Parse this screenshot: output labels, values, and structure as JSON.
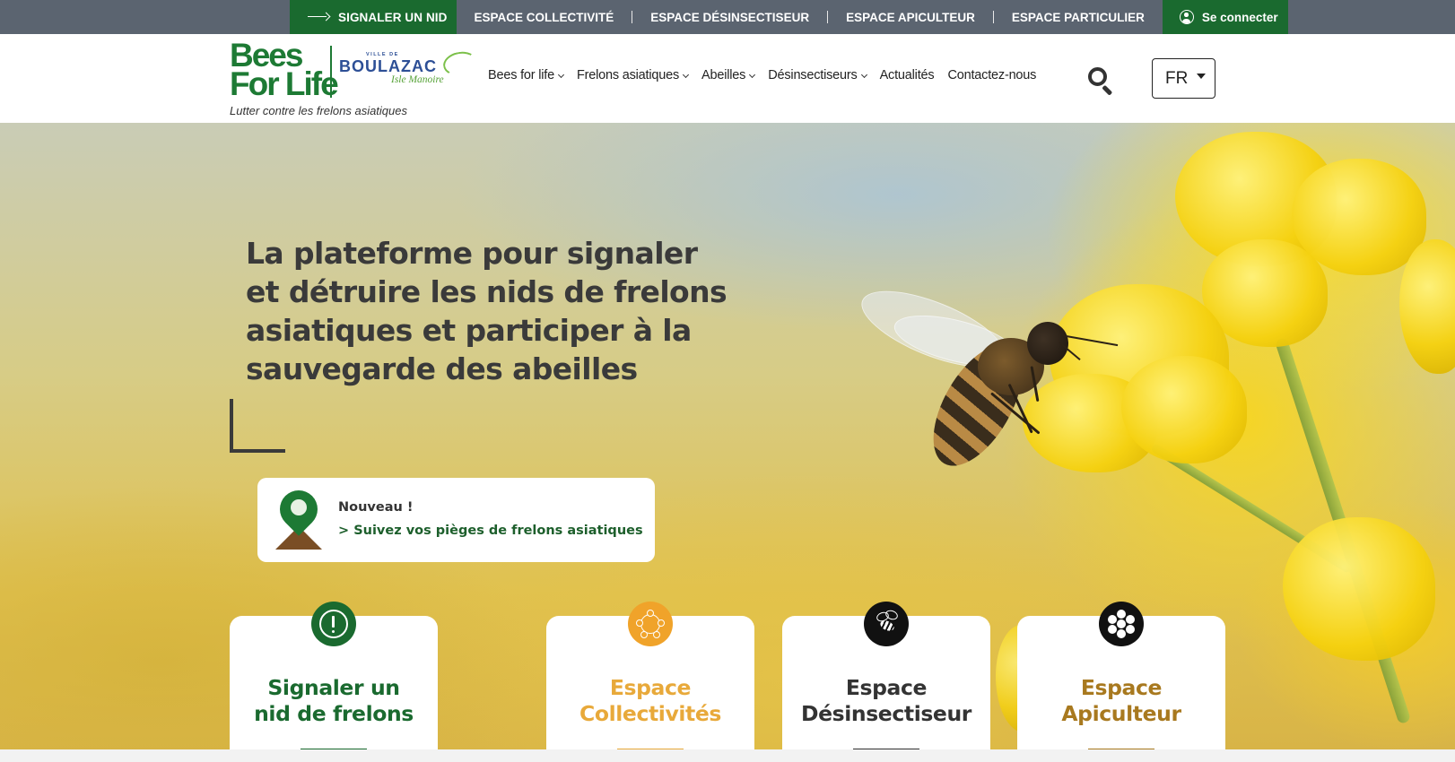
{
  "topbar": {
    "report_label": "SIGNALER UN NID",
    "links": [
      "ESPACE COLLECTIVITÉ",
      "ESPACE DÉSINSECTISEUR",
      "ESPACE APICULTEUR",
      "ESPACE PARTICULIER"
    ],
    "login_label": "Se connecter"
  },
  "header": {
    "logo": {
      "bees_line1": "Bees",
      "bees_line2": "For Life",
      "ville_de": "VILLE DE",
      "city": "BOULAZAC",
      "city_sub": "Isle Manoire"
    },
    "tagline": "Lutter contre les frelons asiatiques",
    "nav": [
      {
        "label": "Bees for life",
        "dropdown": true
      },
      {
        "label": "Frelons asiatiques",
        "dropdown": true
      },
      {
        "label": "Abeilles",
        "dropdown": true
      },
      {
        "label": "Désinsectiseurs",
        "dropdown": true
      },
      {
        "label": "Actualités",
        "dropdown": false
      },
      {
        "label": "Contactez-nous",
        "dropdown": false
      }
    ],
    "language": "FR"
  },
  "hero": {
    "title_parts": {
      "p1": "La plateforme pour ",
      "p2": "signaler et détruire les nids de frelons",
      "p3": " asiatiques et participer à la sauvegarde des abeilles"
    },
    "news": {
      "label": "Nouveau !",
      "link": "> Suivez vos pièges de frelons asiatiques"
    }
  },
  "cards": [
    {
      "line1": "Signaler un",
      "line2": "nid de frelons",
      "color": "#1a6a2f",
      "icon_bg": "#1a6a2f",
      "icon": "exclamation-icon"
    },
    {
      "line1": "Espace",
      "line2": "Collectivités",
      "color": "#e8a93a",
      "icon_bg": "#f0a32a",
      "icon": "network-icon"
    },
    {
      "line1": "Espace",
      "line2": "Désinsectiseur",
      "color": "#333333",
      "icon_bg": "#111111",
      "icon": "bee-icon"
    },
    {
      "line1": "Espace",
      "line2": "Apiculteur",
      "color": "#a8791f",
      "icon_bg": "#111111",
      "icon": "honeycomb-icon"
    }
  ]
}
